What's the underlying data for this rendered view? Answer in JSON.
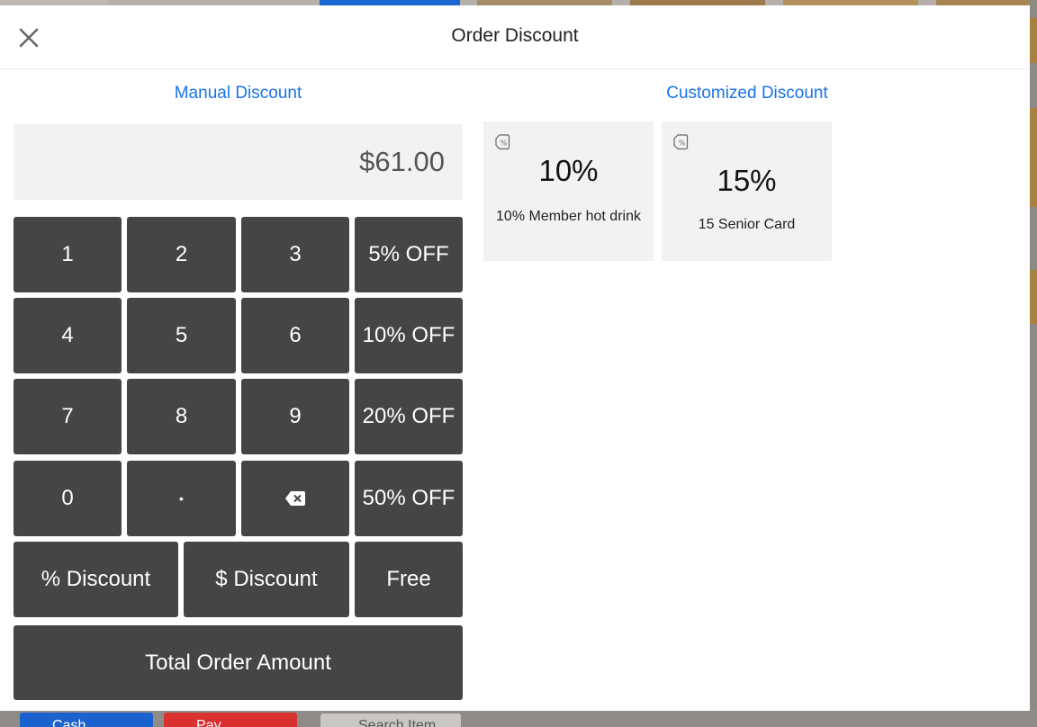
{
  "modal": {
    "title": "Order Discount",
    "manual_label": "Manual Discount",
    "custom_label": "Customized Discount",
    "amount": "$61.00"
  },
  "keypad": {
    "k1": "1",
    "k2": "2",
    "k3": "3",
    "p5": "5% OFF",
    "k4": "4",
    "k5": "5",
    "k6": "6",
    "p10": "10% OFF",
    "k7": "7",
    "k8": "8",
    "k9": "9",
    "p20": "20% OFF",
    "k0": "0",
    "dot": "•",
    "p50": "50% OFF",
    "percent_discount": "% Discount",
    "dollar_discount": "$ Discount",
    "free": "Free",
    "total_order_amount": "Total Order Amount"
  },
  "custom_discounts": [
    {
      "value": "10%",
      "name": "10% Member hot drink"
    },
    {
      "value": "15%",
      "name": "15 Senior Card"
    }
  ],
  "background": {
    "search_placeholder": "Search Item",
    "btn_blue": "Cash",
    "btn_red": "Pay"
  },
  "colors": {
    "accent": "#1a73e8",
    "key_bg": "#464444",
    "card_bg": "#f2f2f2"
  }
}
